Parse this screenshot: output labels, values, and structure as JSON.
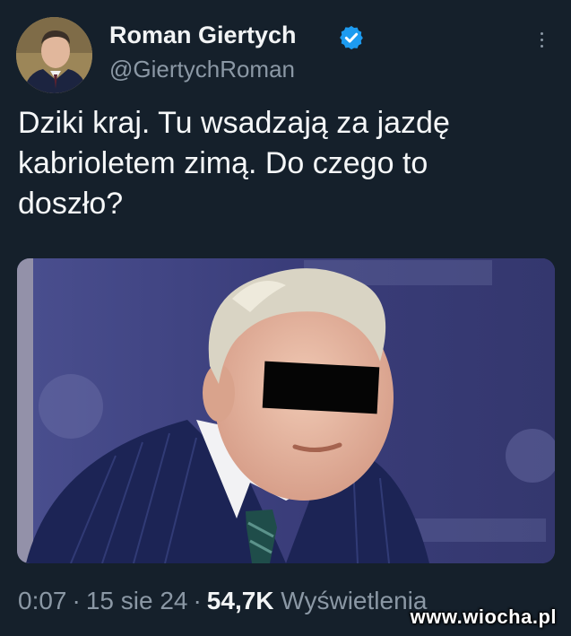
{
  "author": {
    "name": "Roman Giertych",
    "handle": "@GiertychRoman",
    "verified": true,
    "avatar_icon": "profile-photo"
  },
  "tweet": {
    "text_lines": [
      "Dziki kraj. Tu wsadzają za jazdę",
      "kabrioletem zimą. Do czego to",
      "doszło?"
    ]
  },
  "media": {
    "content": "photo-man-censored-eyes"
  },
  "meta": {
    "time": "0:07",
    "separator": "·",
    "date": "15 sie 24",
    "views_count": "54,7K",
    "views_label": "Wyświetlenia"
  },
  "watermark": "www.wiocha.pl",
  "colors": {
    "background": "#15202b",
    "text": "#e7e9ea",
    "muted": "#8b98a5",
    "verified": "#1d9bf0"
  }
}
